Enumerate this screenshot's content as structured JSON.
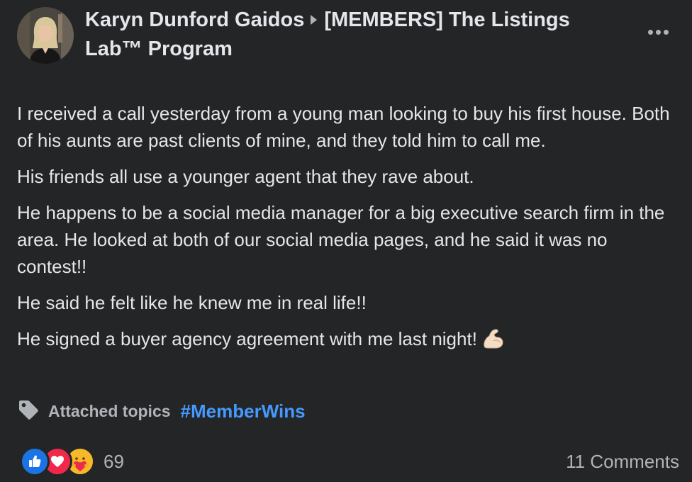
{
  "post": {
    "author": "Karyn Dunford Gaidos",
    "group": "[MEMBERS] The Listings Lab™ Program",
    "paragraphs": [
      "I received a call yesterday from a young man looking to buy his first house. Both of his aunts are past clients of mine, and they told him to call me.",
      "His friends all use a younger agent that they rave about.",
      "He happens to be a social media manager for a big executive search firm in the area. He looked at both of our social media pages, and he said it was no contest!!",
      "He said he felt like he knew me in real life!!",
      "He signed a buyer agency agreement with me last night!"
    ],
    "emoji": "flexed-biceps",
    "topics_label": "Attached topics",
    "hashtag": "#MemberWins"
  },
  "footer": {
    "reaction_icons": [
      "like-icon",
      "love-icon",
      "care-icon"
    ],
    "reaction_count": "69",
    "comments": "11 Comments"
  },
  "colors": {
    "background": "#242526",
    "text": "#e4e6eb",
    "secondary_text": "#b0b3b8",
    "link": "#4599ff",
    "like": "#1b74e4",
    "love": "#f02849",
    "care": "#f7b928"
  }
}
